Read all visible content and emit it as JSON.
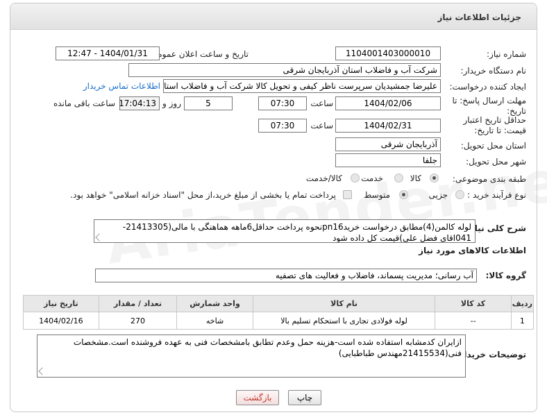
{
  "header": {
    "title": "جزئیات اطلاعات نیاز"
  },
  "fields": {
    "need_number_label": "شماره نیاز:",
    "need_number": "1104001403000010",
    "announce_label": "تاریخ و ساعت اعلان عمومی:",
    "announce_value": "1404/01/31 - 12:47",
    "buyer_org_label": "نام دستگاه خریدار:",
    "buyer_org": "شرکت آب و فاضلاب استان آذربایجان شرقی",
    "creator_label": "ایجاد کننده درخواست:",
    "creator": "علیرضا جمشیدیان سرپرست ناظر کیفی و تحویل کالا شرکت آب و فاضلاب استان",
    "contact_link": "اطلاعات تماس خریدار",
    "reply_deadline_label": "مهلت ارسال پاسخ: تا تاریخ:",
    "reply_date": "1404/02/06",
    "time_label": "ساعت",
    "reply_time": "07:30",
    "days_value": "5",
    "days_label": "روز و",
    "remaining_time": "17:04:13",
    "remaining_label": "ساعت باقی مانده",
    "price_validity_label": "حداقل تاریخ اعتبار قیمت: تا تاریخ:",
    "validity_date": "1404/02/31",
    "validity_time_label": "ساعت",
    "validity_time": "07:30",
    "province_label": "استان محل تحویل:",
    "province": "آذربایجان شرقی",
    "city_label": "شهر محل تحویل:",
    "city": "جلفا",
    "category_label": "طبقه بندی موضوعی:",
    "category_options": [
      "کالا",
      "خدمت",
      "کالا/خدمت"
    ],
    "process_label": "نوع فرآیند خرید :",
    "process_options": [
      "جزیی",
      "متوسط"
    ],
    "treasury_note": "پرداخت تمام یا بخشی از مبلغ خرید،از محل \"اسناد خزانه اسلامی\" خواهد بود.",
    "description_label": "شرح کلی نیاز:",
    "description": "لوله کالمن(4)مطابق درخواست خریدpn16نحوه پرداخت حداقل6ماهه هماهنگی با مالی(21413305-041اقای فضل علی)قیمت کل داده شود",
    "goods_info_title": "اطلاعات کالاهای مورد نیاز",
    "goods_group_label": "گروه کالا:",
    "goods_group": "آب رسانی؛ مدیریت پسماند، فاضلاب و فعالیت های تصفیه",
    "buyer_notes_label": "توضیحات خریدار:",
    "buyer_notes": "ازایران کدمشابه استفاده شده است-هزینه حمل وعدم تطابق بامشخصات فنی به عهده فروشنده است.مشخصات فنی(21415534مهندس طباطبایی)"
  },
  "table": {
    "headers": [
      "ردیف",
      "کد کالا",
      "نام کالا",
      "واحد شمارش",
      "تعداد / مقدار",
      "تاریخ نیاز"
    ],
    "rows": [
      [
        "1",
        "--",
        "لوله فولادی تجاری با استحکام تسلیم بالا",
        "شاخه",
        "270",
        "1404/02/16"
      ]
    ]
  },
  "buttons": {
    "print": "چاپ",
    "back": "بازگشت"
  },
  "watermark": "AriaTender.neT",
  "colors": {
    "link": "#1a6fc8",
    "back_button_text": "#c0392b"
  }
}
